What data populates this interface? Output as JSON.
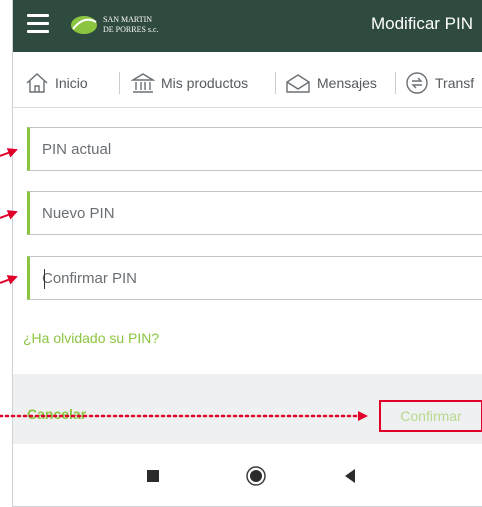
{
  "header": {
    "title": "Modificar PIN",
    "logo_text_line1": "SAN MARTIN",
    "logo_text_line2": "DE PORRES s.c.",
    "background": "#2f4a3e"
  },
  "tabs": [
    {
      "label": "Inicio",
      "icon": "home-icon"
    },
    {
      "label": "Mis productos",
      "icon": "bank-icon"
    },
    {
      "label": "Mensajes",
      "icon": "mail-icon"
    },
    {
      "label": "Transf",
      "icon": "transfer-icon"
    }
  ],
  "form": {
    "current_pin_placeholder": "PIN actual",
    "new_pin_placeholder": "Nuevo PIN",
    "confirm_pin_placeholder": "Confirmar PIN",
    "forgot_link": "¿Ha olvidado su PIN?"
  },
  "actions": {
    "cancel_label": "Cancelar",
    "confirm_label": "Confirmar"
  },
  "android_nav": [
    "recents-icon",
    "home-button-icon",
    "back-icon"
  ],
  "colors": {
    "accent_green": "#8bc53f",
    "annotation_red": "#e0002a",
    "action_bar_bg": "#eef0f1"
  }
}
